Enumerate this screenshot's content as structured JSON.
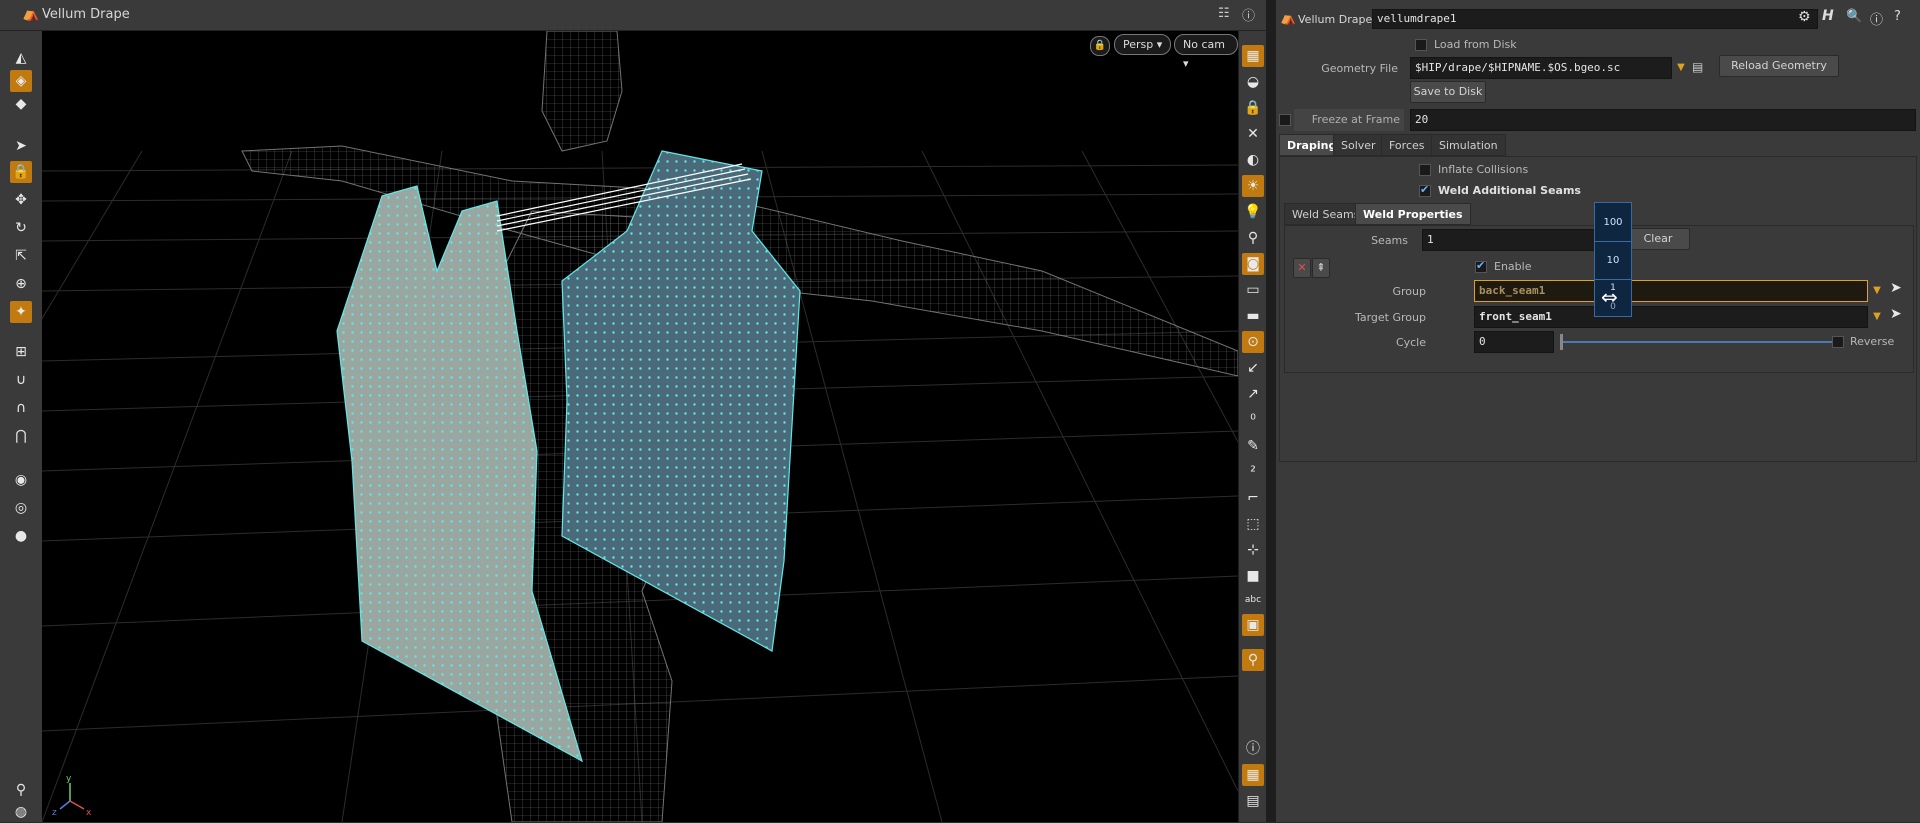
{
  "viewport": {
    "title": "Vellum Drape",
    "persp_label": "Persp",
    "cam_label": "No cam",
    "axis_labels": [
      "y",
      "x",
      "z"
    ]
  },
  "panel": {
    "node_type": "Vellum Drape",
    "node_name": "vellumdrape1",
    "load_from_disk_label": "Load from Disk",
    "geometry_file_label": "Geometry File",
    "geometry_file_value": "$HIP/drape/$HIPNAME.$OS.bgeo.sc",
    "reload_geometry_label": "Reload Geometry",
    "save_to_disk_label": "Save to Disk",
    "freeze_at_frame_label": "Freeze at Frame",
    "freeze_at_frame_value": "20",
    "tabs": [
      "Draping",
      "Solver",
      "Forces",
      "Simulation"
    ],
    "inflate_collisions_label": "Inflate Collisions",
    "weld_additional_seams_label": "Weld Additional Seams",
    "subtabs": [
      "Weld Seams",
      "Weld Properties"
    ],
    "seams_label": "Seams",
    "seams_value": "1",
    "clear_label": "Clear",
    "enable_label": "Enable",
    "group_label": "Group",
    "group_value": "back_seam1",
    "target_group_label": "Target Group",
    "target_group_value": "front_seam1",
    "cycle_label": "Cycle",
    "cycle_value": "0",
    "reverse_label": "Reverse"
  },
  "ladder": [
    "100",
    "10",
    "1",
    "0"
  ],
  "colors": {
    "accent": "#e0a020",
    "selection": "#3a6aa0",
    "points": "#5fe8e8"
  }
}
